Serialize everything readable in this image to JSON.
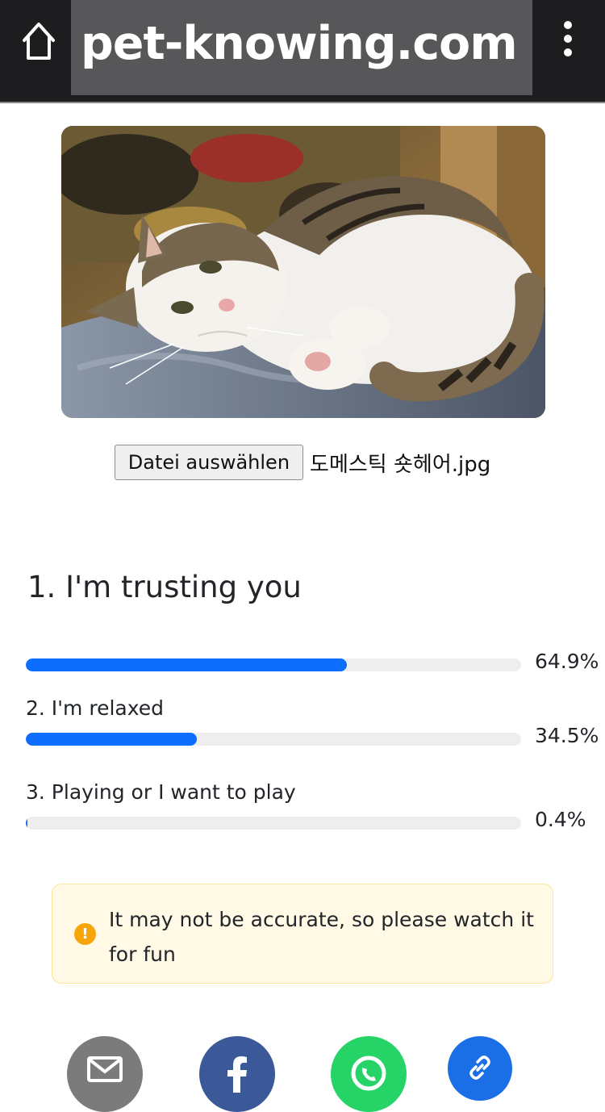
{
  "browser": {
    "url": "pet-knowing.com",
    "home_icon": "home-icon",
    "menu_icon": "more-vertical-icon"
  },
  "photo": {
    "icon": "cat-photo"
  },
  "file_picker": {
    "button_label": "Datei auswählen",
    "file_name": "도메스틱 숏헤어.jpg"
  },
  "results": {
    "title": "1. I'm trusting you",
    "items": [
      {
        "label": "",
        "percent_text": "64.9%",
        "value": 64.9
      },
      {
        "label": "2. I'm relaxed",
        "percent_text": "34.5%",
        "value": 34.5
      },
      {
        "label": "3. Playing or I want to play",
        "percent_text": "0.4%",
        "value": 0.4
      }
    ],
    "bar_color": "#0d6efd",
    "track_color": "#eeeeee"
  },
  "notice": {
    "icon": "exclamation-icon",
    "text": "It may not be accurate, so please watch it for fun"
  },
  "share": {
    "buttons": [
      {
        "name": "email",
        "icon": "envelope-icon",
        "color": "#7b7b7b"
      },
      {
        "name": "facebook",
        "icon": "facebook-icon",
        "color": "#3b5998"
      },
      {
        "name": "whatsapp",
        "icon": "whatsapp-icon",
        "color": "#25d366"
      },
      {
        "name": "copy-link",
        "icon": "link-icon",
        "color": "#1b6fe6"
      }
    ]
  }
}
